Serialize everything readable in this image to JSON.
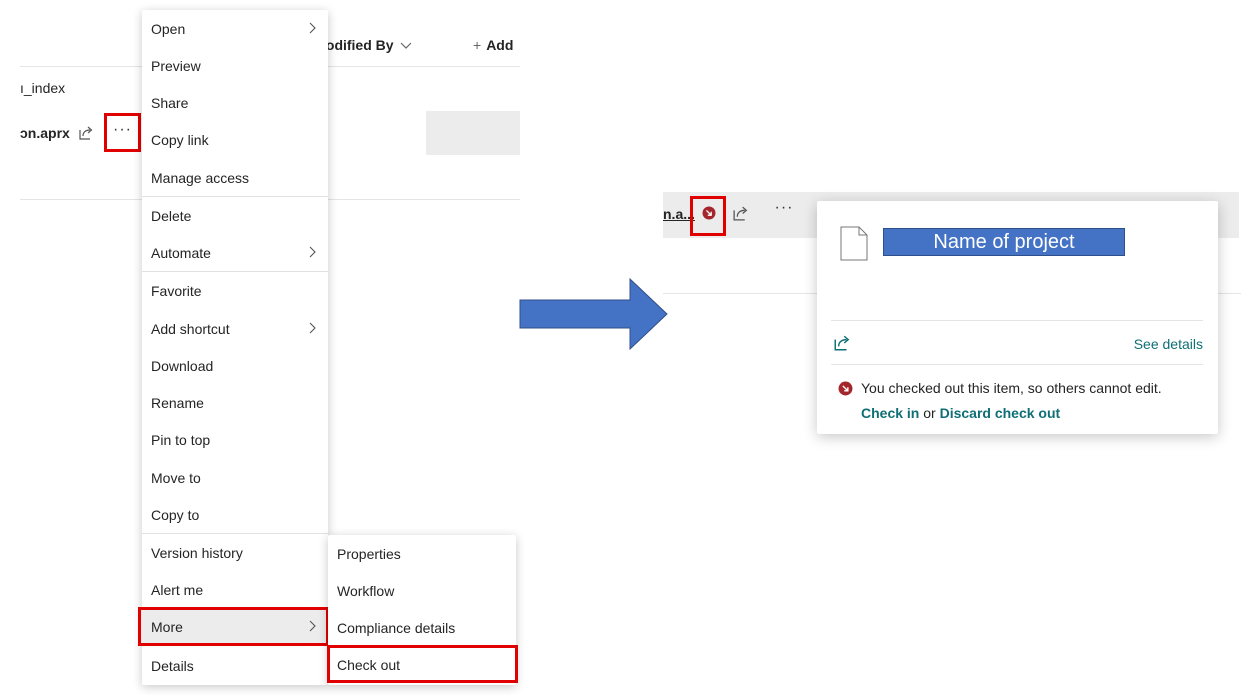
{
  "left_panel": {
    "column_header_modified_by": "lodified By",
    "add_column": "Add",
    "row_partial_name": "ı_index",
    "selected_file_name": "ɔn.aprx"
  },
  "context_menu": {
    "items": [
      {
        "label": "Open",
        "has_submenu": true
      },
      {
        "label": "Preview",
        "has_submenu": false
      },
      {
        "label": "Share",
        "has_submenu": false
      },
      {
        "label": "Copy link",
        "has_submenu": false
      },
      {
        "label": "Manage access",
        "has_submenu": false
      },
      {
        "label": "Delete",
        "has_submenu": false
      },
      {
        "label": "Automate",
        "has_submenu": true
      },
      {
        "label": "Favorite",
        "has_submenu": false
      },
      {
        "label": "Add shortcut",
        "has_submenu": true
      },
      {
        "label": "Download",
        "has_submenu": false
      },
      {
        "label": "Rename",
        "has_submenu": false
      },
      {
        "label": "Pin to top",
        "has_submenu": false
      },
      {
        "label": "Move to",
        "has_submenu": false
      },
      {
        "label": "Copy to",
        "has_submenu": false
      },
      {
        "label": "Version history",
        "has_submenu": false
      },
      {
        "label": "Alert me",
        "has_submenu": false
      },
      {
        "label": "More",
        "has_submenu": true
      },
      {
        "label": "Details",
        "has_submenu": false
      }
    ]
  },
  "more_submenu": {
    "items": [
      {
        "label": "Properties"
      },
      {
        "label": "Workflow"
      },
      {
        "label": "Compliance details"
      },
      {
        "label": "Check out"
      }
    ]
  },
  "right_panel": {
    "file_name_truncated": "n.a...",
    "callout": {
      "project_name": "Name of project",
      "see_details": "See details",
      "checkout_message": "You checked out this item, so others cannot edit.",
      "check_in": "Check in",
      "or_text": "or",
      "discard_checkout": "Discard check out"
    }
  },
  "colors": {
    "highlight_red": "#e00000",
    "arrow_blue": "#4472c4",
    "link_teal": "#0f6f75",
    "checkout_badge": "#a4262c"
  }
}
